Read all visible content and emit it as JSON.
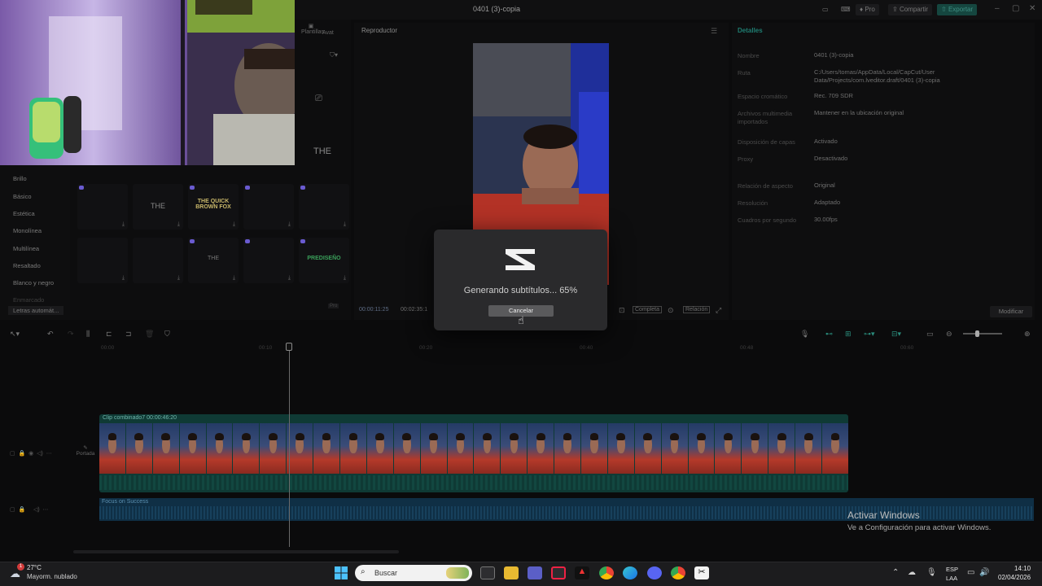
{
  "window": {
    "title": "0401 (3)-copia",
    "pro_label": "Pro",
    "share_label": "Compartir",
    "export_label": "Exportar"
  },
  "left_panel": {
    "tabs": [
      "Plantillas",
      "Avat"
    ],
    "categories": [
      "Brillo",
      "Básico",
      "Estética",
      "Monolínea",
      "Multilínea",
      "Resaltado",
      "Blanco y negro",
      "Letras automát...",
      "Enmarcado"
    ],
    "tiles_text": [
      "THE",
      "THE",
      "THE QUICK BROWN FOX",
      "THE",
      "PREDISEÑO"
    ],
    "tile_pro": "Pro"
  },
  "player": {
    "title": "Reproductor",
    "time_current": "00:00:11:25",
    "time_total": "00:02:35:1",
    "full_label": "Completa",
    "ratio_label": "Relación"
  },
  "details": {
    "title": "Detalles",
    "rows": [
      {
        "key": "Nombre",
        "value": "0401 (3)-copia"
      },
      {
        "key": "Ruta",
        "value": "C:/Users/tomas/AppData/Local/CapCut/User Data/Projects/com.lveditor.draft/0401 (3)-copia"
      },
      {
        "key": "Espacio cromático",
        "value": "Rec. 709 SDR"
      },
      {
        "key": "Archivos multimedia importados",
        "value": "Mantener en la ubicación original"
      },
      {
        "key": "Disposición de capas",
        "value": "Activado"
      },
      {
        "key": "Proxy",
        "value": "Desactivado"
      },
      {
        "key": "Relación de aspecto",
        "value": "Original"
      },
      {
        "key": "Resolución",
        "value": "Adaptado"
      },
      {
        "key": "Cuadros por segundo",
        "value": "30.00fps"
      }
    ],
    "modify_label": "Modificar"
  },
  "timeline": {
    "ticks": [
      "00:00",
      "00:10",
      "00:20",
      "00:40",
      "00:48",
      "00:60"
    ],
    "clip_label": "Clip combinado7  00:00:46:20",
    "audio_label": "Focus on Success",
    "cover_label": "Portada"
  },
  "modal": {
    "message": "Generando subtítulos... 65%",
    "progress_percent": 65,
    "cancel_label": "Cancelar"
  },
  "activation": {
    "title": "Activar Windows",
    "subtitle": "Ve a Configuración para activar Windows."
  },
  "taskbar": {
    "weather_temp": "27°C",
    "weather_desc": "Mayorm. nublado",
    "weather_badge": "1",
    "search_placeholder": "Buscar",
    "lang_top": "ESP",
    "lang_bottom": "LAA",
    "time": "14:10",
    "date": "02/04/2026",
    "icons": [
      "start-icon",
      "search-icon",
      "task-view-icon",
      "file-explorer-icon",
      "teams-icon",
      "app-icon",
      "affinity-icon",
      "chrome-icon",
      "edge-icon",
      "discord-icon",
      "chrome-profile-icon",
      "capcut-icon"
    ]
  }
}
